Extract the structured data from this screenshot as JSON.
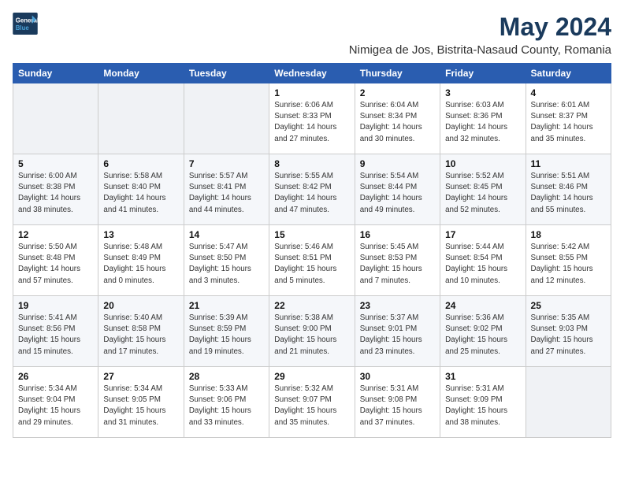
{
  "header": {
    "logo_line1": "General",
    "logo_line2": "Blue",
    "title": "May 2024",
    "subtitle": "Nimigea de Jos, Bistrita-Nasaud County, Romania"
  },
  "columns": [
    "Sunday",
    "Monday",
    "Tuesday",
    "Wednesday",
    "Thursday",
    "Friday",
    "Saturday"
  ],
  "weeks": [
    [
      {
        "day": "",
        "info": ""
      },
      {
        "day": "",
        "info": ""
      },
      {
        "day": "",
        "info": ""
      },
      {
        "day": "1",
        "info": "Sunrise: 6:06 AM\nSunset: 8:33 PM\nDaylight: 14 hours\nand 27 minutes."
      },
      {
        "day": "2",
        "info": "Sunrise: 6:04 AM\nSunset: 8:34 PM\nDaylight: 14 hours\nand 30 minutes."
      },
      {
        "day": "3",
        "info": "Sunrise: 6:03 AM\nSunset: 8:36 PM\nDaylight: 14 hours\nand 32 minutes."
      },
      {
        "day": "4",
        "info": "Sunrise: 6:01 AM\nSunset: 8:37 PM\nDaylight: 14 hours\nand 35 minutes."
      }
    ],
    [
      {
        "day": "5",
        "info": "Sunrise: 6:00 AM\nSunset: 8:38 PM\nDaylight: 14 hours\nand 38 minutes."
      },
      {
        "day": "6",
        "info": "Sunrise: 5:58 AM\nSunset: 8:40 PM\nDaylight: 14 hours\nand 41 minutes."
      },
      {
        "day": "7",
        "info": "Sunrise: 5:57 AM\nSunset: 8:41 PM\nDaylight: 14 hours\nand 44 minutes."
      },
      {
        "day": "8",
        "info": "Sunrise: 5:55 AM\nSunset: 8:42 PM\nDaylight: 14 hours\nand 47 minutes."
      },
      {
        "day": "9",
        "info": "Sunrise: 5:54 AM\nSunset: 8:44 PM\nDaylight: 14 hours\nand 49 minutes."
      },
      {
        "day": "10",
        "info": "Sunrise: 5:52 AM\nSunset: 8:45 PM\nDaylight: 14 hours\nand 52 minutes."
      },
      {
        "day": "11",
        "info": "Sunrise: 5:51 AM\nSunset: 8:46 PM\nDaylight: 14 hours\nand 55 minutes."
      }
    ],
    [
      {
        "day": "12",
        "info": "Sunrise: 5:50 AM\nSunset: 8:48 PM\nDaylight: 14 hours\nand 57 minutes."
      },
      {
        "day": "13",
        "info": "Sunrise: 5:48 AM\nSunset: 8:49 PM\nDaylight: 15 hours\nand 0 minutes."
      },
      {
        "day": "14",
        "info": "Sunrise: 5:47 AM\nSunset: 8:50 PM\nDaylight: 15 hours\nand 3 minutes."
      },
      {
        "day": "15",
        "info": "Sunrise: 5:46 AM\nSunset: 8:51 PM\nDaylight: 15 hours\nand 5 minutes."
      },
      {
        "day": "16",
        "info": "Sunrise: 5:45 AM\nSunset: 8:53 PM\nDaylight: 15 hours\nand 7 minutes."
      },
      {
        "day": "17",
        "info": "Sunrise: 5:44 AM\nSunset: 8:54 PM\nDaylight: 15 hours\nand 10 minutes."
      },
      {
        "day": "18",
        "info": "Sunrise: 5:42 AM\nSunset: 8:55 PM\nDaylight: 15 hours\nand 12 minutes."
      }
    ],
    [
      {
        "day": "19",
        "info": "Sunrise: 5:41 AM\nSunset: 8:56 PM\nDaylight: 15 hours\nand 15 minutes."
      },
      {
        "day": "20",
        "info": "Sunrise: 5:40 AM\nSunset: 8:58 PM\nDaylight: 15 hours\nand 17 minutes."
      },
      {
        "day": "21",
        "info": "Sunrise: 5:39 AM\nSunset: 8:59 PM\nDaylight: 15 hours\nand 19 minutes."
      },
      {
        "day": "22",
        "info": "Sunrise: 5:38 AM\nSunset: 9:00 PM\nDaylight: 15 hours\nand 21 minutes."
      },
      {
        "day": "23",
        "info": "Sunrise: 5:37 AM\nSunset: 9:01 PM\nDaylight: 15 hours\nand 23 minutes."
      },
      {
        "day": "24",
        "info": "Sunrise: 5:36 AM\nSunset: 9:02 PM\nDaylight: 15 hours\nand 25 minutes."
      },
      {
        "day": "25",
        "info": "Sunrise: 5:35 AM\nSunset: 9:03 PM\nDaylight: 15 hours\nand 27 minutes."
      }
    ],
    [
      {
        "day": "26",
        "info": "Sunrise: 5:34 AM\nSunset: 9:04 PM\nDaylight: 15 hours\nand 29 minutes."
      },
      {
        "day": "27",
        "info": "Sunrise: 5:34 AM\nSunset: 9:05 PM\nDaylight: 15 hours\nand 31 minutes."
      },
      {
        "day": "28",
        "info": "Sunrise: 5:33 AM\nSunset: 9:06 PM\nDaylight: 15 hours\nand 33 minutes."
      },
      {
        "day": "29",
        "info": "Sunrise: 5:32 AM\nSunset: 9:07 PM\nDaylight: 15 hours\nand 35 minutes."
      },
      {
        "day": "30",
        "info": "Sunrise: 5:31 AM\nSunset: 9:08 PM\nDaylight: 15 hours\nand 37 minutes."
      },
      {
        "day": "31",
        "info": "Sunrise: 5:31 AM\nSunset: 9:09 PM\nDaylight: 15 hours\nand 38 minutes."
      },
      {
        "day": "",
        "info": ""
      }
    ]
  ]
}
